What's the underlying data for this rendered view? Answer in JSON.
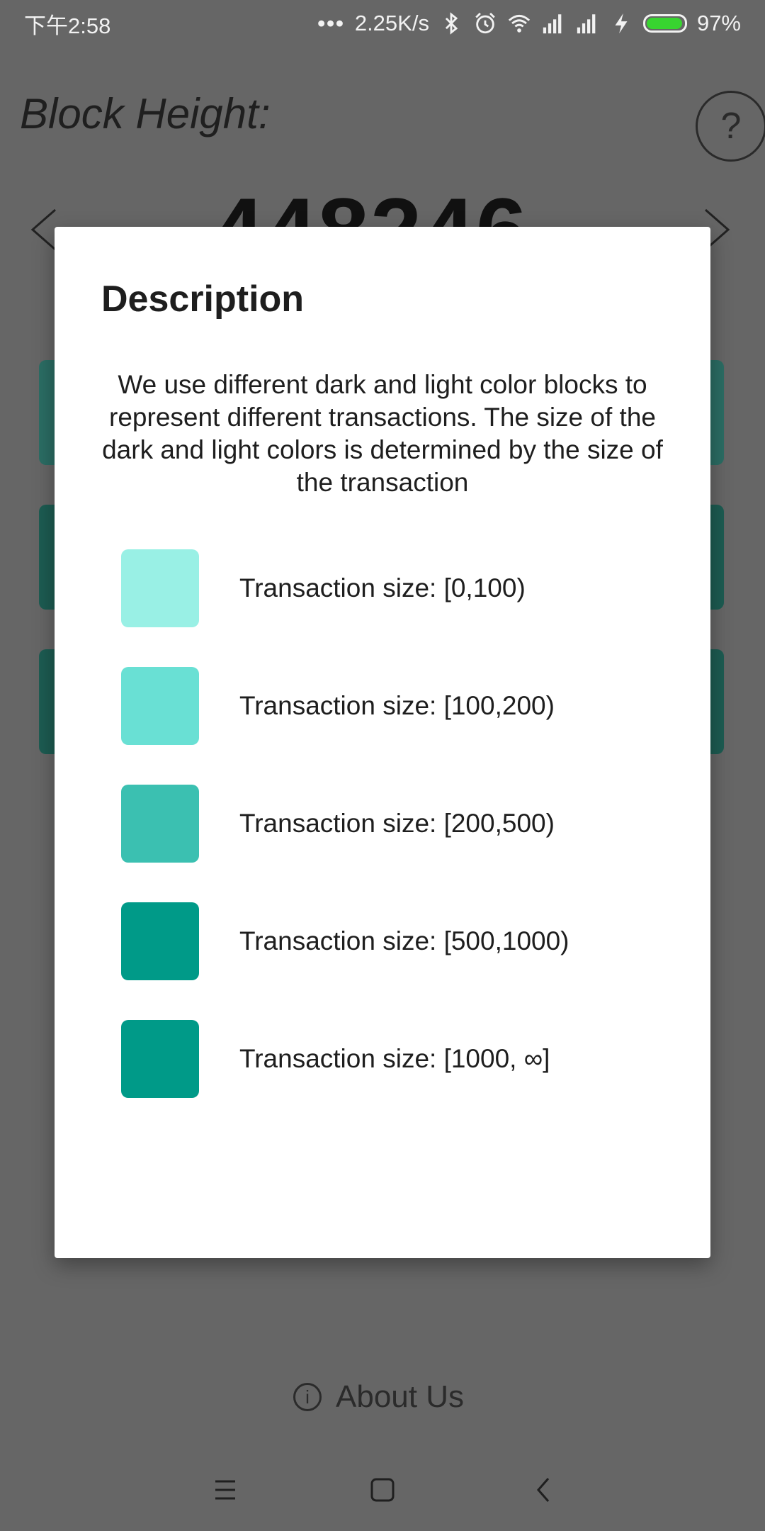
{
  "status_bar": {
    "time": "下午2:58",
    "dots": "•••",
    "network_speed": "2.25K/s",
    "battery_percent": "97%",
    "battery_level": 0.97,
    "icons": [
      "bluetooth-icon",
      "alarm-icon",
      "wifi-icon",
      "signal-icon",
      "signal-icon",
      "charging-icon",
      "battery-icon"
    ]
  },
  "app": {
    "title": "Block Height:",
    "help_label": "?",
    "block_number": "448246",
    "about_label": "About Us",
    "info_glyph": "i"
  },
  "dialog": {
    "title": "Description",
    "description": "We use different dark and light color blocks to represent different transactions. The size of the dark and light colors is determined by the size of the transaction",
    "legend": [
      {
        "label": "Transaction size: [0,100)",
        "color": "#99f0e5"
      },
      {
        "label": "Transaction size: [100,200)",
        "color": "#69e0d4"
      },
      {
        "label": "Transaction size: [200,500)",
        "color": "#3bc0b1"
      },
      {
        "label": "Transaction size: [500,1000)",
        "color": "#009a88"
      },
      {
        "label": "Transaction size: [1000, ∞]",
        "color": "#009a88"
      }
    ]
  },
  "nav_bar": {
    "icons": [
      "menu-icon",
      "home-icon",
      "back-icon"
    ]
  },
  "colors": {
    "scrim": "#666666",
    "dialog_bg": "#ffffff",
    "battery_fill": "#38d430"
  }
}
